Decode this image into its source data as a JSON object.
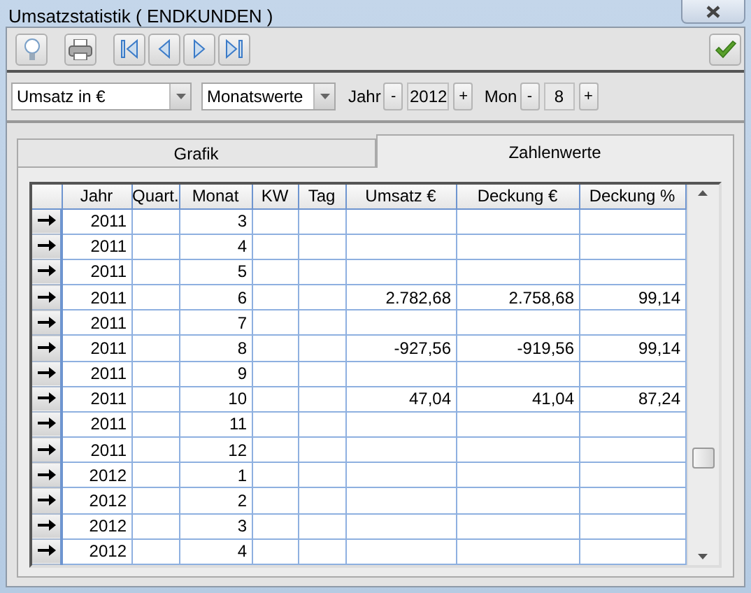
{
  "window": {
    "title": "Umsatzstatistik ( ENDKUNDEN )"
  },
  "toolbar": {
    "buttons": [
      {
        "kind": "bulb"
      },
      {
        "kind": "print"
      },
      {
        "kind": "first"
      },
      {
        "kind": "prev"
      },
      {
        "kind": "next"
      },
      {
        "kind": "last"
      },
      {
        "kind": "ok"
      }
    ]
  },
  "filters": {
    "measure": "Umsatz in €",
    "period": "Monatswerte",
    "year_label": "Jahr",
    "year": "2012",
    "month_label": "Mon",
    "month": "8",
    "minus": "-",
    "plus": "+"
  },
  "tabs": [
    {
      "label": "Grafik",
      "selected": false
    },
    {
      "label": "Zahlenwerte",
      "selected": true
    }
  ],
  "table": {
    "columns": [
      "Jahr",
      "Quart.",
      "Monat",
      "KW",
      "Tag",
      "Umsatz €",
      "Deckung €",
      "Deckung %"
    ],
    "rows": [
      [
        "2011",
        "",
        "3",
        "",
        "",
        "",
        "",
        ""
      ],
      [
        "2011",
        "",
        "4",
        "",
        "",
        "",
        "",
        ""
      ],
      [
        "2011",
        "",
        "5",
        "",
        "",
        "",
        "",
        ""
      ],
      [
        "2011",
        "",
        "6",
        "",
        "",
        "2.782,68",
        "2.758,68",
        "99,14"
      ],
      [
        "2011",
        "",
        "7",
        "",
        "",
        "",
        "",
        ""
      ],
      [
        "2011",
        "",
        "8",
        "",
        "",
        "-927,56",
        "-919,56",
        "99,14"
      ],
      [
        "2011",
        "",
        "9",
        "",
        "",
        "",
        "",
        ""
      ],
      [
        "2011",
        "",
        "10",
        "",
        "",
        "47,04",
        "41,04",
        "87,24"
      ],
      [
        "2011",
        "",
        "11",
        "",
        "",
        "",
        "",
        ""
      ],
      [
        "2011",
        "",
        "12",
        "",
        "",
        "",
        "",
        ""
      ],
      [
        "2012",
        "",
        "1",
        "",
        "",
        "",
        "",
        ""
      ],
      [
        "2012",
        "",
        "2",
        "",
        "",
        "",
        "",
        ""
      ],
      [
        "2012",
        "",
        "3",
        "",
        "",
        "",
        "",
        ""
      ],
      [
        "2012",
        "",
        "4",
        "",
        "",
        "",
        "",
        ""
      ]
    ]
  }
}
